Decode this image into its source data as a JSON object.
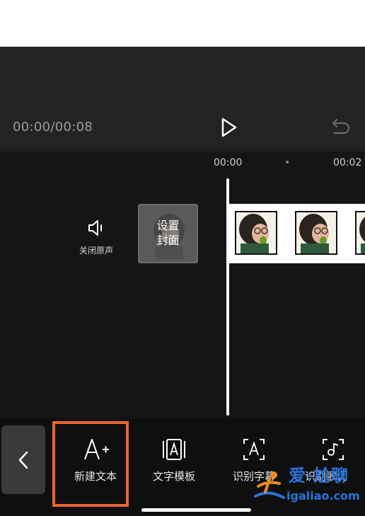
{
  "player": {
    "time": "00:00/00:08",
    "play_icon": "play-icon",
    "undo_icon": "undo-icon"
  },
  "timeline": {
    "ticks": [
      "00:00",
      "00:02"
    ],
    "mute_label": "关闭原声",
    "mute_icon": "speaker-icon",
    "cover_label": "设置\n封面"
  },
  "toolbar": {
    "back_icon": "chevron-left-icon",
    "tools": [
      {
        "label": "新建文本",
        "icon": "add-text-icon"
      },
      {
        "label": "文字模板",
        "icon": "text-template-icon"
      },
      {
        "label": "识别字幕",
        "icon": "recognize-subtitles-icon"
      },
      {
        "label": "识别歌词",
        "icon": "recognize-lyrics-icon"
      }
    ]
  },
  "highlight": {
    "color": "#ec6430"
  },
  "watermark": {
    "brand": "爱·尬聊",
    "url": "igaliao.com",
    "color": "#2a73d9"
  },
  "colors": {
    "player_bg": "#232325",
    "timeline_bg": "#151515",
    "toolbar_bg": "#0f0f0f"
  }
}
